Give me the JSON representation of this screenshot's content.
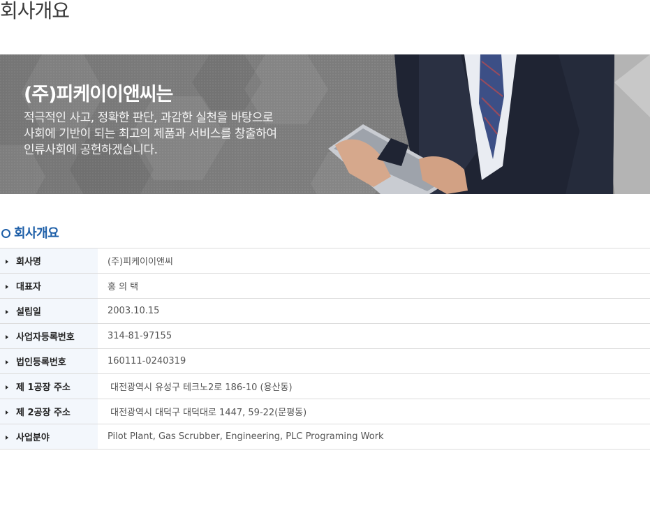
{
  "page": {
    "title": "회사개요"
  },
  "banner": {
    "heading": "(주)피케이이앤씨는",
    "lines": [
      "적극적인 사고, 정확한 판단, 과감한 실천을 바탕으로",
      "사회에 기반이 되는 최고의 제품과 서비스를 창출하여",
      "인류사회에 공헌하겠습니다."
    ]
  },
  "section": {
    "title": "회사개요",
    "icon": "ring-icon",
    "accent_color": "#1e5fa8"
  },
  "company_info": {
    "rows": [
      {
        "label": "회사명",
        "value": "(주)피케이이앤씨"
      },
      {
        "label": "대표자",
        "value": "홍 의 택"
      },
      {
        "label": "설립일",
        "value": "2003.10.15"
      },
      {
        "label": "사업자등록번호",
        "value": "314-81-97155"
      },
      {
        "label": "법인등록번호",
        "value": "160111-0240319"
      },
      {
        "label": "제 1공장 주소",
        "value": " 대전광역시 유성구 테크노2로 186-10 (용산동)"
      },
      {
        "label": "제 2공장 주소",
        "value": " 대전광역시 대덕구 대덕대로 1447, 59-22(문평동)"
      },
      {
        "label": "사업분야",
        "value": "Pilot Plant, Gas Scrubber, Engineering, PLC Programing Work"
      }
    ]
  }
}
